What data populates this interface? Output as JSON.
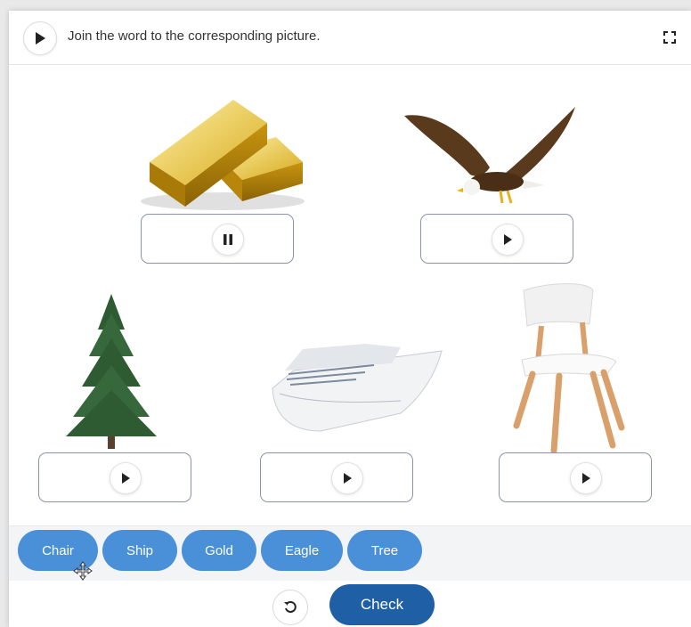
{
  "header": {
    "instruction": "Join the word to the corresponding picture.",
    "play_icon": "play-icon",
    "fullscreen_icon": "fullscreen-icon"
  },
  "pictures": [
    {
      "id": "gold",
      "audio_state": "playing",
      "audio_icon": "pause-icon"
    },
    {
      "id": "eagle",
      "audio_state": "stopped",
      "audio_icon": "play-icon"
    },
    {
      "id": "tree",
      "audio_state": "stopped",
      "audio_icon": "play-icon"
    },
    {
      "id": "ship",
      "audio_state": "stopped",
      "audio_icon": "play-icon"
    },
    {
      "id": "chair",
      "audio_state": "stopped",
      "audio_icon": "play-icon"
    }
  ],
  "words": [
    {
      "label": "Chair"
    },
    {
      "label": "Ship"
    },
    {
      "label": "Gold"
    },
    {
      "label": "Eagle"
    },
    {
      "label": "Tree"
    }
  ],
  "footer": {
    "reset_icon": "reset-icon",
    "check_label": "Check"
  },
  "colors": {
    "chip": "#4a90d9",
    "check_button": "#1f5fa6",
    "dropbox_border": "#8b93a7"
  }
}
